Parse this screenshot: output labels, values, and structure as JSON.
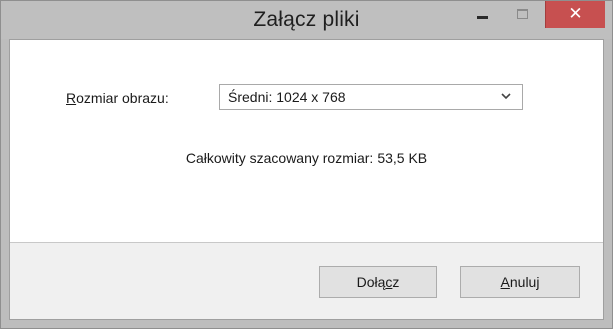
{
  "window": {
    "title": "Załącz pliki",
    "close_glyph": "✕"
  },
  "image_size": {
    "label_mnemonic": "R",
    "label_rest": "ozmiar obrazu:",
    "selected": "Średni: 1024 x 768"
  },
  "estimate": {
    "label": "Całkowity szacowany rozmiar:",
    "value": "53,5 KB"
  },
  "buttons": {
    "attach_before": "Dołą",
    "attach_mnemonic": "c",
    "attach_after": "z",
    "cancel_mnemonic": "A",
    "cancel_rest": "nuluj"
  },
  "icons": {
    "minimize": "minimize-icon",
    "maximize": "maximize-icon",
    "close": "close-icon",
    "dropdown": "chevron-down-icon"
  },
  "colors": {
    "close_button": "#c75050",
    "titlebar": "#bfbfbf",
    "footer": "#f0f0f0"
  }
}
